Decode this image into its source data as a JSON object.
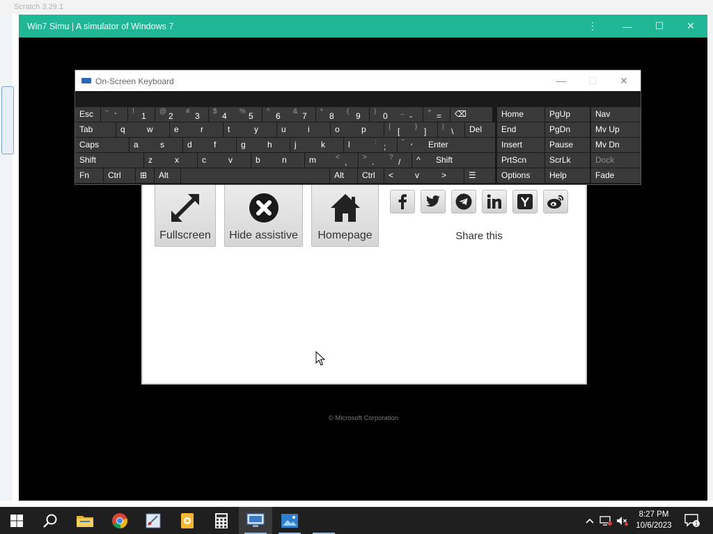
{
  "host": {
    "title_fragment": "Scratch 3.29.1"
  },
  "window": {
    "title": "Win7 Simu | A simulator of Windows 7",
    "controls": {
      "more": "⋮",
      "minimize": "—",
      "maximize": "☐",
      "close": "✕"
    }
  },
  "osk": {
    "title": "On-Screen Keyboard",
    "controls": {
      "minimize": "—",
      "maximize": "☐",
      "close": "✕"
    },
    "rows": [
      [
        {
          "m": "Esc"
        },
        {
          "s": "~",
          "p": "`"
        },
        {
          "s": "!",
          "p": "1"
        },
        {
          "s": "@",
          "p": "2"
        },
        {
          "s": "#",
          "p": "3"
        },
        {
          "s": "$",
          "p": "4"
        },
        {
          "s": "%",
          "p": "5"
        },
        {
          "s": "^",
          "p": "6"
        },
        {
          "s": "&",
          "p": "7"
        },
        {
          "s": "*",
          "p": "8"
        },
        {
          "s": "(",
          "p": "9"
        },
        {
          "s": ")",
          "p": "0"
        },
        {
          "s": "_",
          "p": "-"
        },
        {
          "s": "+",
          "p": "="
        },
        {
          "m": "⌫"
        }
      ],
      [
        {
          "m": "Tab"
        },
        {
          "m": "q"
        },
        {
          "m": "w"
        },
        {
          "m": "e"
        },
        {
          "m": "r"
        },
        {
          "m": "t"
        },
        {
          "m": "y"
        },
        {
          "m": "u"
        },
        {
          "m": "i"
        },
        {
          "m": "o"
        },
        {
          "m": "p"
        },
        {
          "s": "{",
          "p": "["
        },
        {
          "s": "}",
          "p": "]"
        },
        {
          "s": "|",
          "p": "\\"
        },
        {
          "m": "Del"
        }
      ],
      [
        {
          "m": "Caps"
        },
        {
          "m": "a"
        },
        {
          "m": "s"
        },
        {
          "m": "d"
        },
        {
          "m": "f"
        },
        {
          "m": "g"
        },
        {
          "m": "h"
        },
        {
          "m": "j"
        },
        {
          "m": "k"
        },
        {
          "m": "l"
        },
        {
          "s": ":",
          "p": ";"
        },
        {
          "s": "\"",
          "p": "'"
        },
        {
          "m": "Enter"
        }
      ],
      [
        {
          "m": "Shift"
        },
        {
          "m": "z"
        },
        {
          "m": "x"
        },
        {
          "m": "c"
        },
        {
          "m": "v"
        },
        {
          "m": "b"
        },
        {
          "m": "n"
        },
        {
          "m": "m"
        },
        {
          "s": "<",
          "p": ","
        },
        {
          "s": ">",
          "p": "."
        },
        {
          "s": "?",
          "p": "/"
        },
        {
          "m": "^"
        },
        {
          "m": "Shift"
        }
      ],
      [
        {
          "m": "Fn"
        },
        {
          "m": "Ctrl"
        },
        {
          "m": "⊞"
        },
        {
          "m": "Alt"
        },
        {
          "m": ""
        },
        {
          "m": "Alt"
        },
        {
          "m": "Ctrl"
        },
        {
          "m": "<"
        },
        {
          "m": "v"
        },
        {
          "m": ">"
        },
        {
          "m": "☰"
        }
      ]
    ],
    "nav": [
      [
        "Home",
        "PgUp",
        "Nav"
      ],
      [
        "End",
        "PgDn",
        "Mv Up"
      ],
      [
        "Insert",
        "Pause",
        "Mv Dn"
      ],
      [
        "PrtScn",
        "ScrLk",
        "Dock"
      ],
      [
        "Options",
        "Help",
        "Fade"
      ]
    ]
  },
  "assistive": {
    "buttons": [
      {
        "label": "Fullscreen",
        "icon": "expand-icon"
      },
      {
        "label": "Hide assistive",
        "icon": "close-circle-icon"
      },
      {
        "label": "Homepage",
        "icon": "home-icon"
      }
    ],
    "social": [
      "facebook-icon",
      "twitter-icon",
      "telegram-icon",
      "linkedin-icon",
      "hacker-news-icon",
      "weibo-icon"
    ],
    "share_label": "Share this"
  },
  "copyright": "© Microsoft Corporation",
  "taskbar": {
    "apps": [
      "start-icon",
      "search-icon",
      "file-explorer-icon",
      "chrome-icon",
      "paint-icon",
      "scratch-icon",
      "calculator-icon",
      "remote-desktop-icon",
      "photos-icon",
      "blank-app-icon"
    ],
    "clock": {
      "time": "8:27 PM",
      "date": "10/6/2023"
    },
    "notification_count": "1"
  }
}
